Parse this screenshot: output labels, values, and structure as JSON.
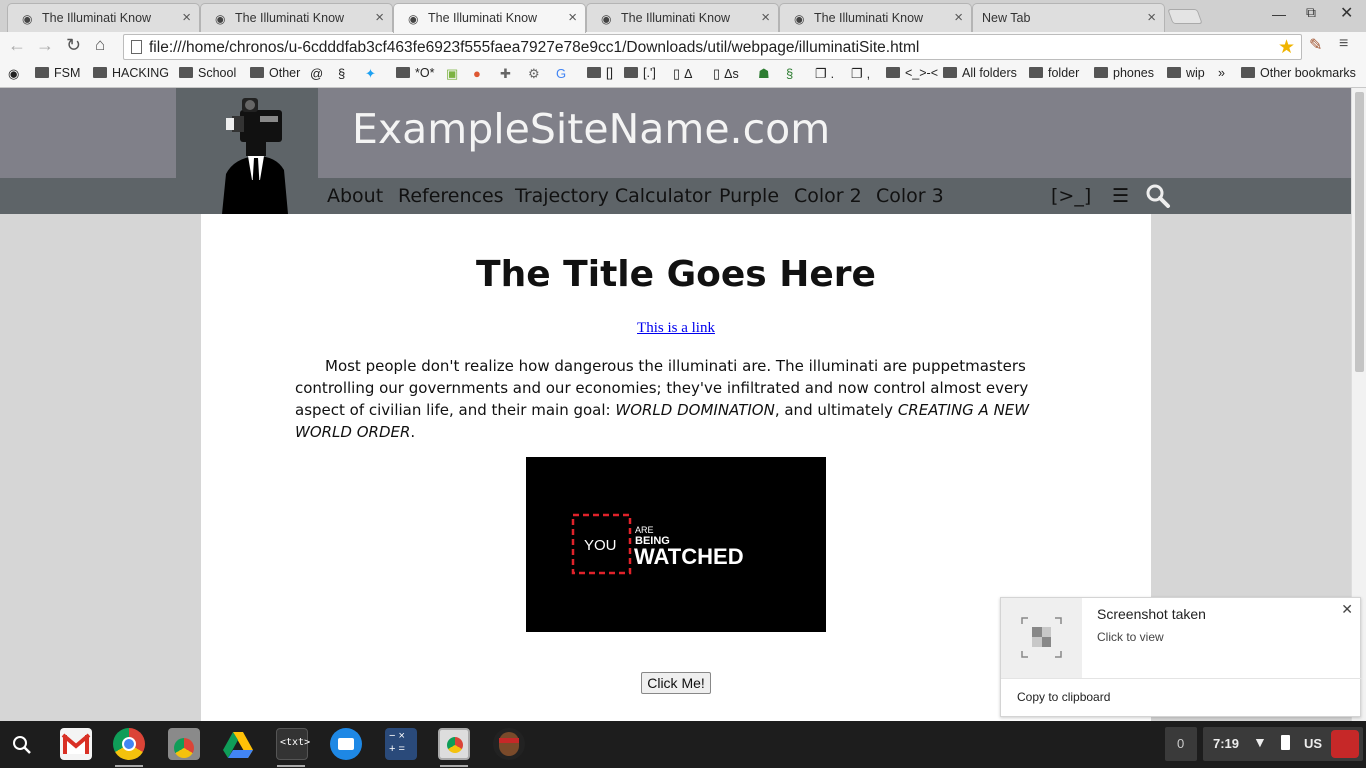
{
  "tabs": [
    {
      "title": "The Illuminati Know",
      "active": false
    },
    {
      "title": "The Illuminati Know",
      "active": false
    },
    {
      "title": "The Illuminati Know",
      "active": true
    },
    {
      "title": "The Illuminati Know",
      "active": false
    },
    {
      "title": "The Illuminati Know",
      "active": false
    },
    {
      "title": "New Tab",
      "active": false
    }
  ],
  "omnibox": {
    "url": "file:///home/chronos/u-6cdddfab3cf463fe6923f555faea7927e78e9cc1/Downloads/util/webpage/illuminatiSite.html"
  },
  "bookmarks": [
    {
      "label": "",
      "icon": "eye-icon"
    },
    {
      "label": "FSM",
      "icon": "folder-icon"
    },
    {
      "label": "HACKING",
      "icon": "folder-icon"
    },
    {
      "label": "School",
      "icon": "folder-icon"
    },
    {
      "label": "Other",
      "icon": "folder-icon"
    },
    {
      "label": "",
      "icon": "swirl-icon"
    },
    {
      "label": "",
      "icon": "s-logo-icon"
    },
    {
      "label": "",
      "icon": "twitter-icon"
    },
    {
      "label": "*O*",
      "icon": "folder-icon"
    },
    {
      "label": "",
      "icon": "android-icon"
    },
    {
      "label": "",
      "icon": "duckduckgo-icon"
    },
    {
      "label": "",
      "icon": "puzzle-icon"
    },
    {
      "label": "",
      "icon": "gear-icon"
    },
    {
      "label": "",
      "icon": "translate-icon"
    },
    {
      "label": "[]",
      "icon": "folder-icon"
    },
    {
      "label": "[.']",
      "icon": "folder-icon"
    },
    {
      "label": "Δ",
      "icon": "page-icon"
    },
    {
      "label": "Δs",
      "icon": "page-icon"
    },
    {
      "label": "",
      "icon": "alien-icon"
    },
    {
      "label": "",
      "icon": "snake-icon"
    },
    {
      "label": ".",
      "icon": "pages-icon"
    },
    {
      "label": ",",
      "icon": "pages-icon"
    },
    {
      "label": "<_>-<",
      "icon": "folder-icon"
    },
    {
      "label": "All folders",
      "icon": "folder-icon"
    },
    {
      "label": "folder",
      "icon": "folder-icon"
    },
    {
      "label": "phones",
      "icon": "folder-icon"
    },
    {
      "label": "wip",
      "icon": "folder-icon"
    },
    {
      "label": "»",
      "icon": "chevron-double-icon"
    },
    {
      "label": "Other bookmarks",
      "icon": "folder-icon"
    }
  ],
  "site": {
    "name": "ExampleSiteName.com",
    "nav": [
      "About",
      "References",
      "Trajectory Calculator",
      "Purple",
      "Color 2",
      "Color 3"
    ],
    "nav_right": {
      "terminal": "[>_]",
      "menu": "☰"
    },
    "title": "The Title Goes Here",
    "link": "This is a link",
    "para_1": "Most people don't realize how dangerous the illuminati are. The illuminati are puppetmasters controlling our governments and our economies; they've infiltrated and now control almost every aspect of civilian life, and their main goal: ",
    "para_em_1": "WORLD DOMINATION",
    "para_2": ", and ultimately ",
    "para_em_2": "CREATING A NEW WORLD ORDER",
    "para_3": ".",
    "banner": {
      "you": "YOU",
      "are": "ARE",
      "being": "BEING",
      "watched": "WATCHED"
    },
    "button": "Click Me!"
  },
  "notification": {
    "title": "Screenshot taken",
    "subtitle": "Click to view",
    "action": "Copy to clipboard"
  },
  "tray": {
    "count": "0",
    "time": "7:19",
    "ime": "US"
  },
  "colors": {
    "header": "#808089",
    "navbar": "#5e6468",
    "page_bg": "#d6d6d6",
    "banner_red": "#e0222a"
  }
}
